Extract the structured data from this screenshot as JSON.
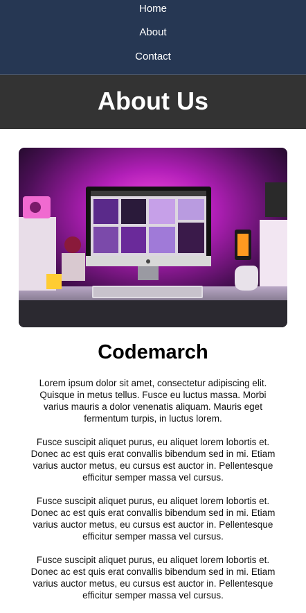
{
  "nav": {
    "items": [
      "Home",
      "About",
      "Contact"
    ]
  },
  "hero": {
    "title": "About Us"
  },
  "image": {
    "description_icon": "desk-setup-photo"
  },
  "section": {
    "title": "Codemarch",
    "paragraphs": [
      "Lorem ipsum dolor sit amet, consectetur adipiscing elit. Quisque in metus tellus. Fusce eu luctus massa. Morbi varius mauris a dolor venenatis aliquam. Mauris eget fermentum turpis, in luctus lorem.",
      "Fusce suscipit aliquet purus, eu aliquet lorem lobortis et. Donec ac est quis erat convallis bibendum sed in mi. Etiam varius auctor metus, eu cursus est auctor in. Pellentesque efficitur semper massa vel cursus.",
      "Fusce suscipit aliquet purus, eu aliquet lorem lobortis et. Donec ac est quis erat convallis bibendum sed in mi. Etiam varius auctor metus, eu cursus est auctor in. Pellentesque efficitur semper massa vel cursus.",
      "Fusce suscipit aliquet purus, eu aliquet lorem lobortis et. Donec ac est quis erat convallis bibendum sed in mi. Etiam varius auctor metus, eu cursus est auctor in. Pellentesque efficitur semper massa vel cursus."
    ]
  },
  "colors": {
    "nav_bg": "#263753",
    "hero_bg": "#333333",
    "accent_glow": "#e020d0"
  }
}
